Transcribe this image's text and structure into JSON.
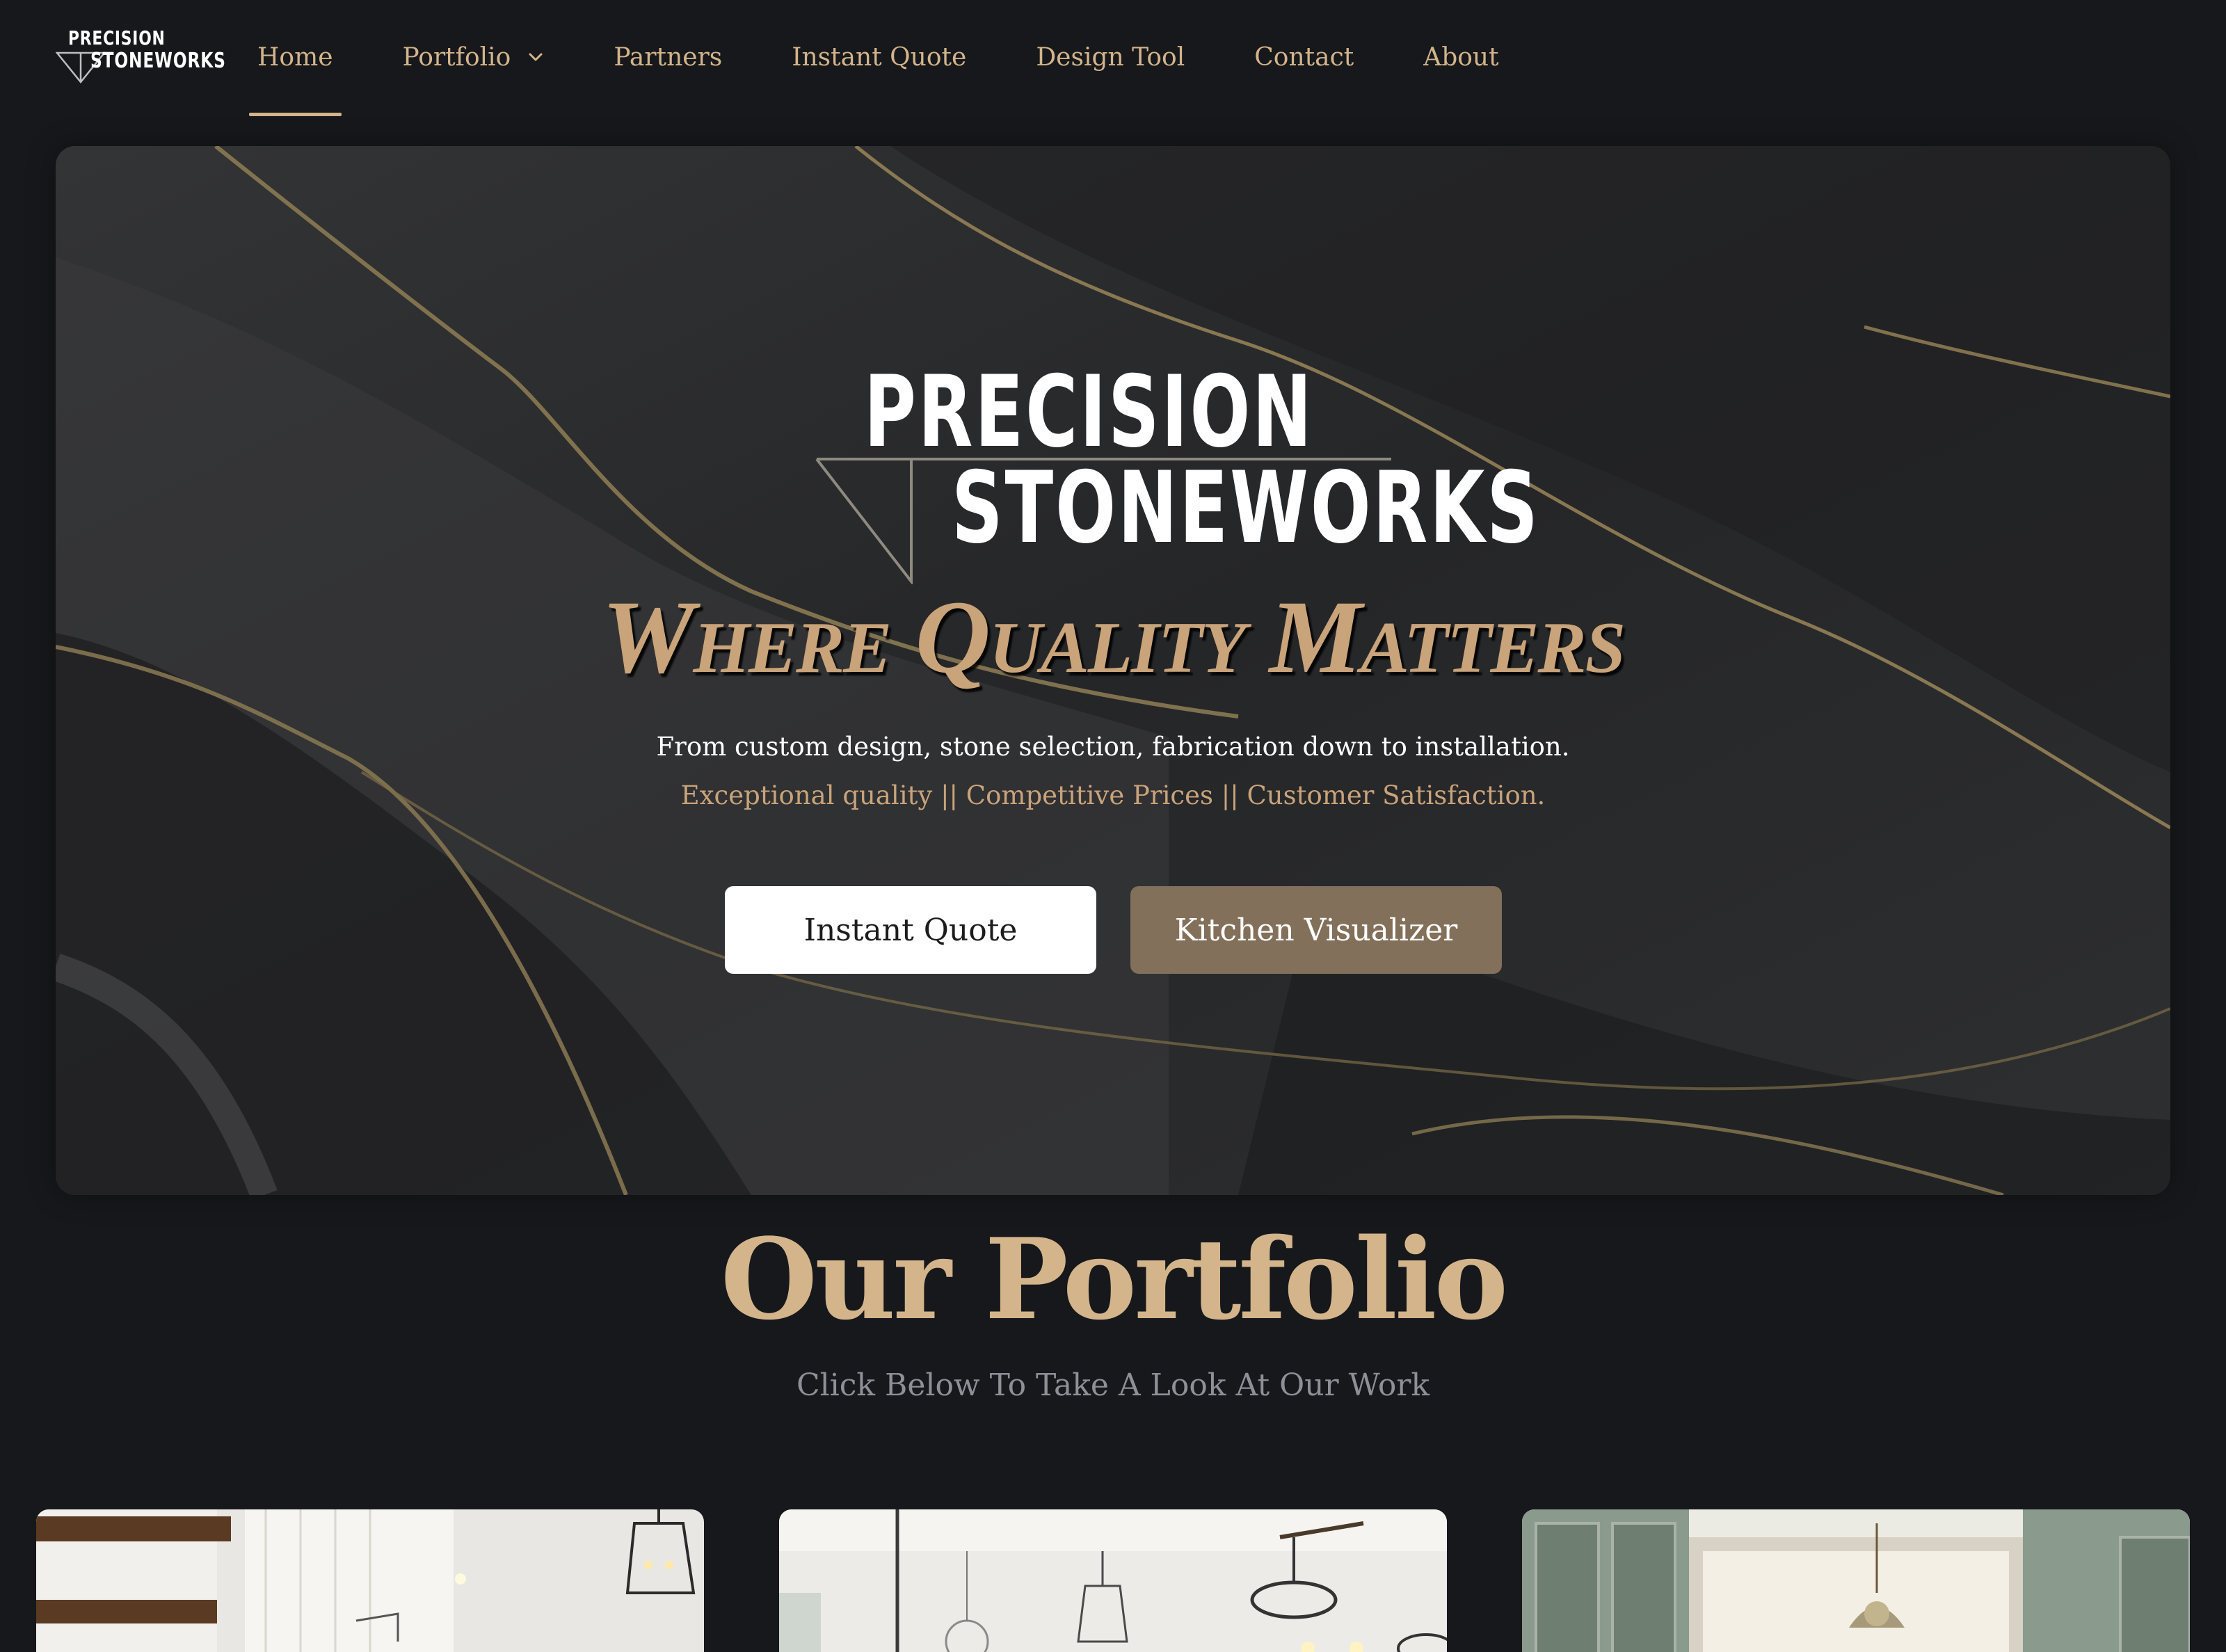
{
  "brand": {
    "line1": "PRECISION",
    "line2": "STONEWORKS"
  },
  "nav": {
    "items": [
      {
        "label": "Home",
        "active": true
      },
      {
        "label": "Portfolio",
        "has_dropdown": true
      },
      {
        "label": "Partners"
      },
      {
        "label": "Instant Quote"
      },
      {
        "label": "Design Tool"
      },
      {
        "label": "Contact"
      },
      {
        "label": "About"
      }
    ]
  },
  "hero": {
    "logo_line1": "PRECISION",
    "logo_line2": "STONEWORKS",
    "tagline": "Where Quality Matters",
    "subtitle": "From custom design, stone selection, fabrication down to installation.",
    "values": "Exceptional quality || Competitive Prices || Customer Satisfaction.",
    "buttons": {
      "quote": "Instant Quote",
      "visualizer": "Kitchen Visualizer"
    }
  },
  "portfolio": {
    "title": "Our Portfolio",
    "subtitle": "Click Below To Take A Look At Our Work",
    "cards": [
      {
        "icon": "kitchen-photo-icon"
      },
      {
        "icon": "kitchen-photo-icon"
      },
      {
        "icon": "kitchen-photo-icon"
      }
    ]
  },
  "colors": {
    "background": "#16181b",
    "accent_gold": "#d3b48b",
    "button_bronze": "#83705a",
    "muted_text": "#8f8f95"
  }
}
